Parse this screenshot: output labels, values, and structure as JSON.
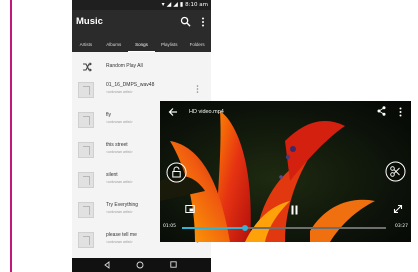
{
  "app": {
    "title": "Music"
  },
  "status": {
    "time": "8:10 am"
  },
  "tabs": [
    {
      "label": "Artists"
    },
    {
      "label": "Albums"
    },
    {
      "label": "Songs",
      "active": true
    },
    {
      "label": "Playlists"
    },
    {
      "label": "Folders"
    }
  ],
  "list": {
    "shuffle_label": "Random Play All",
    "songs": [
      {
        "title": "01_16_DMPS_wav48",
        "artist": "<unknown artist>"
      },
      {
        "title": "fly",
        "artist": "<unknown artist>"
      },
      {
        "title": "this street",
        "artist": "<unknown artist>"
      },
      {
        "title": "silent",
        "artist": "<unknown artist>"
      },
      {
        "title": "Try Everything",
        "artist": "<unknown artist>"
      },
      {
        "title": "please tell me",
        "artist": "<unknown artist>"
      }
    ]
  },
  "video": {
    "title": "HD video.mp4",
    "current_time": "01:05",
    "total_time": "03:27",
    "progress": 0.31
  },
  "colors": {
    "accent": "#2fb4d8",
    "appbar": "#2b2b2b",
    "side_line": "#c2187a"
  },
  "icons": {
    "search": "search-icon",
    "more": "more-icon",
    "shuffle": "shuffle-icon",
    "back": "back-icon",
    "share": "share-icon",
    "lock": "lock-icon",
    "cut": "cut-icon",
    "pip": "picture-in-picture-icon",
    "pause": "pause-icon",
    "fullscreen": "fullscreen-icon"
  }
}
